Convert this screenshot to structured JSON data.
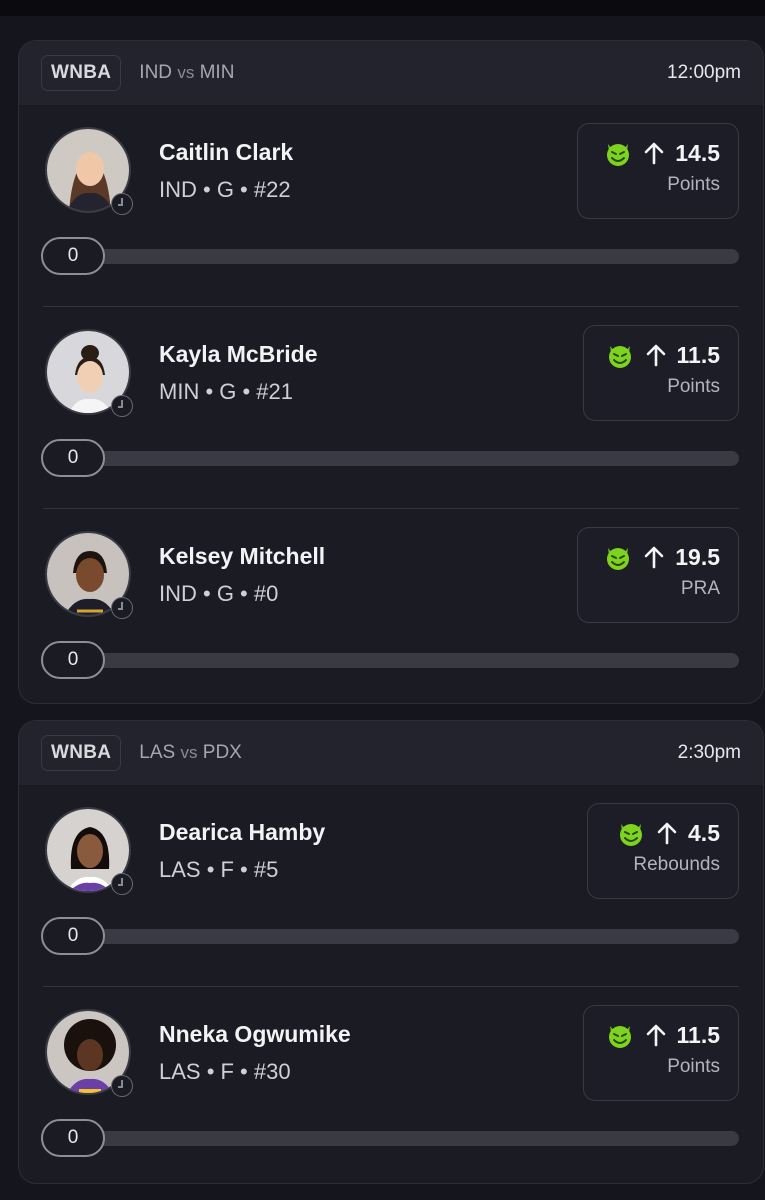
{
  "games": [
    {
      "league": "WNBA",
      "home": "IND",
      "vs": "vs",
      "away": "MIN",
      "time": "12:00pm",
      "players": [
        {
          "name": "Caitlin Clark",
          "meta": "IND • G • #22",
          "line": "14.5",
          "stat": "Points",
          "progress": "0"
        },
        {
          "name": "Kayla McBride",
          "meta": "MIN • G • #21",
          "line": "11.5",
          "stat": "Points",
          "progress": "0"
        },
        {
          "name": "Kelsey Mitchell",
          "meta": "IND • G • #0",
          "line": "19.5",
          "stat": "PRA",
          "progress": "0"
        }
      ]
    },
    {
      "league": "WNBA",
      "home": "LAS",
      "vs": "vs",
      "away": "PDX",
      "time": "2:30pm",
      "players": [
        {
          "name": "Dearica Hamby",
          "meta": "LAS • F • #5",
          "line": "4.5",
          "stat": "Rebounds",
          "progress": "0"
        },
        {
          "name": "Nneka Ogwumike",
          "meta": "LAS • F • #30",
          "line": "11.5",
          "stat": "Points",
          "progress": "0"
        }
      ]
    }
  ],
  "icons": {
    "pick": "devil-emoji-icon",
    "direction": "arrow-up-icon",
    "status": "clock-icon"
  },
  "colors": {
    "background": "#15151d",
    "card": "#1b1b24",
    "header": "#23232d",
    "devil": "#7ed321"
  }
}
